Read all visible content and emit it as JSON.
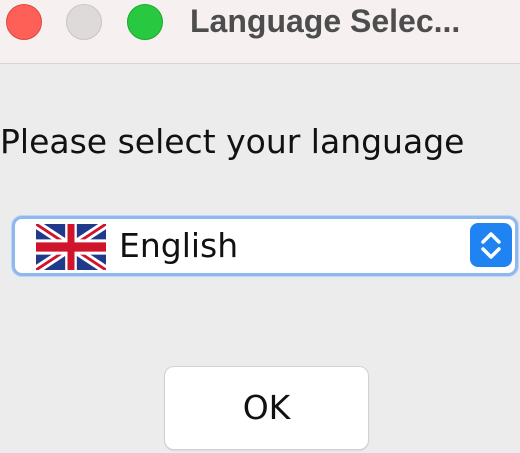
{
  "window": {
    "title": "Language Selec...",
    "controls": [
      "close-button",
      "minimize-button",
      "zoom-button"
    ]
  },
  "dialog": {
    "prompt": "Please select your language",
    "language_select": {
      "selected": "English",
      "flag_icon": "uk-flag-icon"
    },
    "ok_label": "OK"
  },
  "colors": {
    "close": "#fe5f57",
    "minimize": "#dedad9",
    "zoom": "#28c840",
    "select_border": "#8fb9ee",
    "stepper": "#1f84f2"
  }
}
